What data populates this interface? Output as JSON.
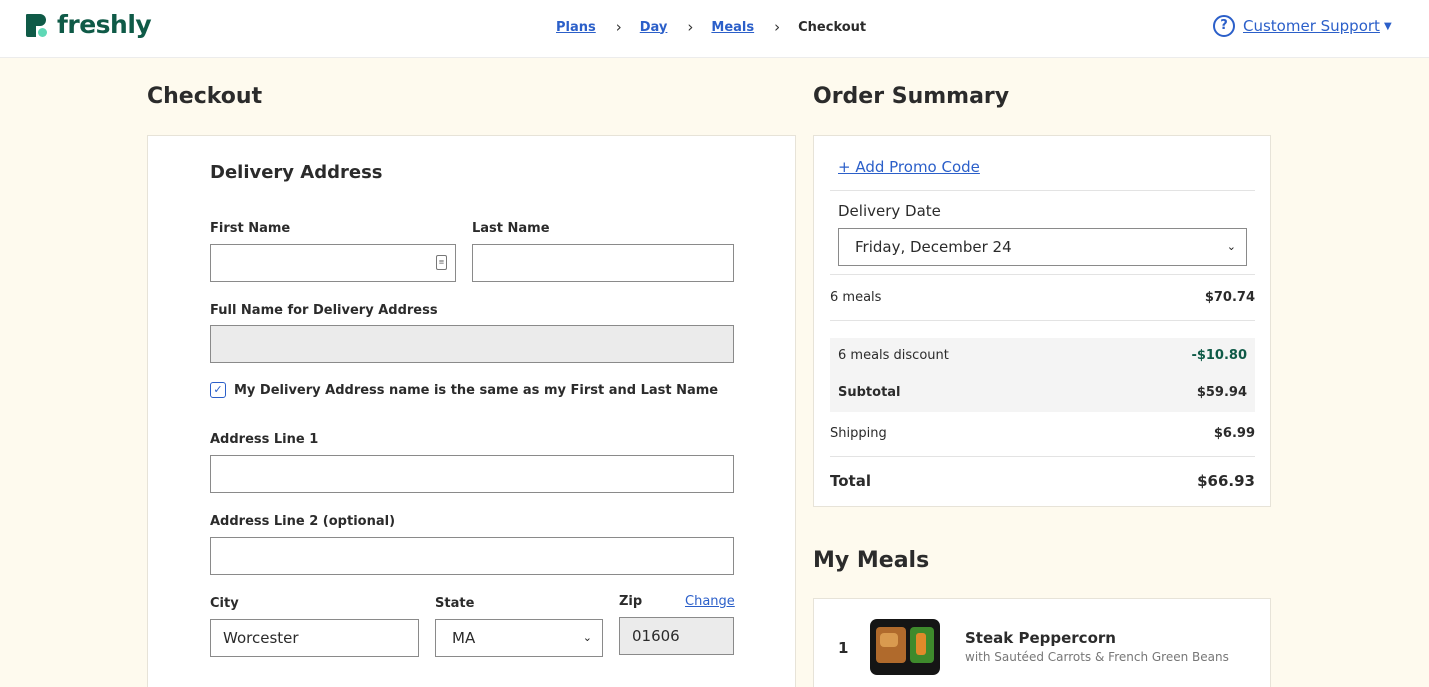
{
  "brand": {
    "name": "freshly"
  },
  "breadcrumb": {
    "items": [
      {
        "label": "Plans"
      },
      {
        "label": "Day"
      },
      {
        "label": "Meals"
      }
    ],
    "current": "Checkout"
  },
  "support": {
    "icon_glyph": "?",
    "label": "Customer Support"
  },
  "checkout": {
    "title": "Checkout",
    "section_title": "Delivery Address",
    "first_name": {
      "label": "First Name",
      "value": ""
    },
    "last_name": {
      "label": "Last Name",
      "value": ""
    },
    "full_name": {
      "label": "Full Name for Delivery Address",
      "value": ""
    },
    "same_name": {
      "label": "My Delivery Address name is the same as my First and Last Name",
      "checked": true
    },
    "address1": {
      "label": "Address Line 1",
      "value": ""
    },
    "address2": {
      "label": "Address Line 2 (optional)",
      "value": ""
    },
    "city": {
      "label": "City",
      "value": "Worcester"
    },
    "state": {
      "label": "State",
      "value": "MA"
    },
    "zip": {
      "label": "Zip",
      "value": "01606",
      "change_label": "Change"
    }
  },
  "summary": {
    "title": "Order Summary",
    "promo_label": "+ Add Promo Code",
    "delivery_date": {
      "label": "Delivery Date",
      "value": "Friday, December 24"
    },
    "meals": {
      "label": "6 meals",
      "value": "$70.74"
    },
    "discount": {
      "label": "6 meals discount",
      "value": "-$10.80"
    },
    "subtotal": {
      "label": "Subtotal",
      "value": "$59.94"
    },
    "shipping": {
      "label": "Shipping",
      "value": "$6.99"
    },
    "total": {
      "label": "Total",
      "value": "$66.93"
    }
  },
  "my_meals": {
    "title": "My Meals",
    "items": [
      {
        "qty": "1",
        "name": "Steak Peppercorn",
        "subtitle": "with Sautéed Carrots & French Green Beans"
      }
    ]
  },
  "colors": {
    "brand": "#0f5a47",
    "link": "#2b5fc9",
    "background": "#fefaee",
    "discount": "#0f5a47"
  }
}
